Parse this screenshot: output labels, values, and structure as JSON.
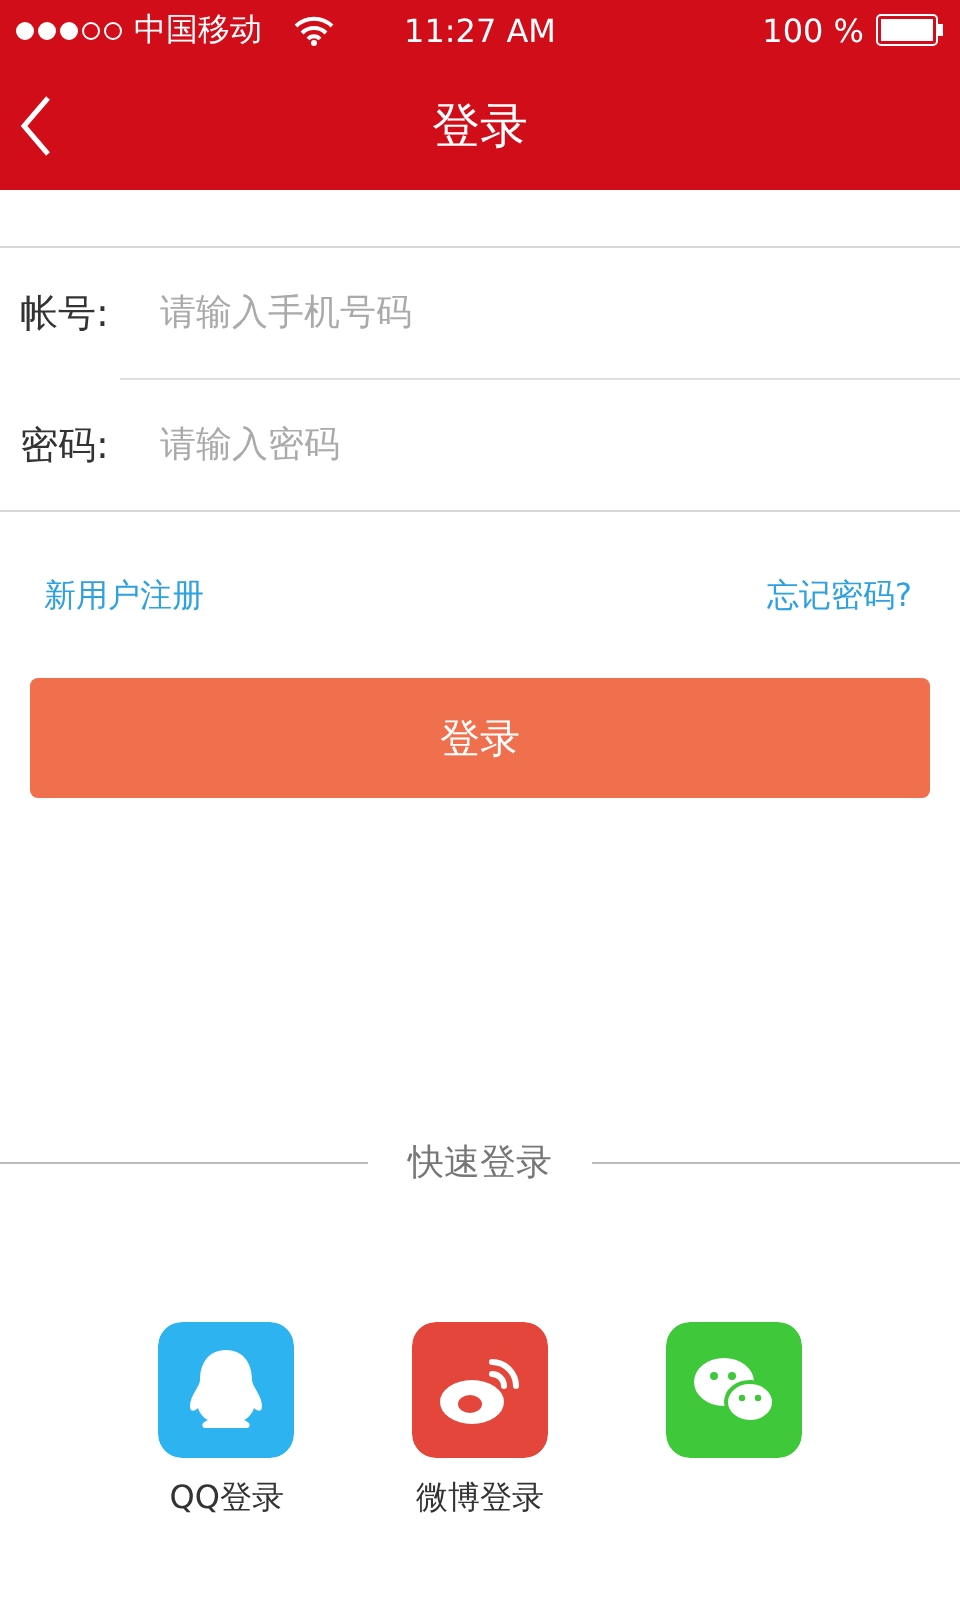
{
  "status_bar": {
    "carrier": "中国移动",
    "signal_dots": [
      {
        "on": true
      },
      {
        "on": true
      },
      {
        "on": true
      },
      {
        "on": false
      },
      {
        "on": false
      }
    ],
    "time": "11:27 AM",
    "battery": "100 %"
  },
  "header": {
    "title": "登录"
  },
  "form": [
    {
      "label": "帐号:",
      "placeholder": "请输入手机号码"
    },
    {
      "label": "密码:",
      "placeholder": "请输入密码"
    }
  ],
  "links": {
    "register": "新用户注册",
    "forgot": "忘记密码?"
  },
  "submit": "登录",
  "quick_login": {
    "title": "快速登录",
    "options": [
      {
        "kind": "qq",
        "label": "QQ登录"
      },
      {
        "kind": "weibo",
        "label": "微博登录"
      },
      {
        "kind": "wechat"
      }
    ]
  }
}
